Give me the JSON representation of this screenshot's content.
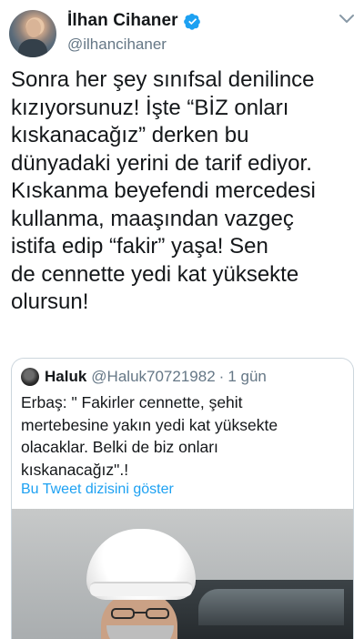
{
  "author": {
    "display_name": "İlhan Cihaner",
    "handle": "@ilhancihaner",
    "verified": true,
    "avatar_icon": "avatar-photo"
  },
  "tweet": {
    "text": "Sonra her şey sınıfsal denilince\nkızıyorsunuz! İşte “BİZ onları\nkıskanacağız” derken bu\ndünyadaki yerini de tarif ediyor.\nKıskanma beyefendi mercedesi\nkullanma, maaşından vazgeç\nistifa edip “fakir” yaşa! Sen\nde cennette yedi kat yüksekte\nolursun!"
  },
  "quoted_tweet": {
    "display_name": "Haluk",
    "handle": "@Haluk70721982",
    "separator": "·",
    "time": "1 gün",
    "text": "Erbaş: \" Fakirler cennette, şehit\nmertebesine yakın yedi kat yüksekte\nolacaklar. Belki de biz onları\nkıskanacağız\".!",
    "show_thread_label": "Bu Tweet dizisini göster",
    "image_icon": "photo-man-in-turban"
  },
  "colors": {
    "accent": "#1da1f2",
    "text": "#14171a",
    "secondary": "#657786",
    "border": "#ccd6dd"
  }
}
